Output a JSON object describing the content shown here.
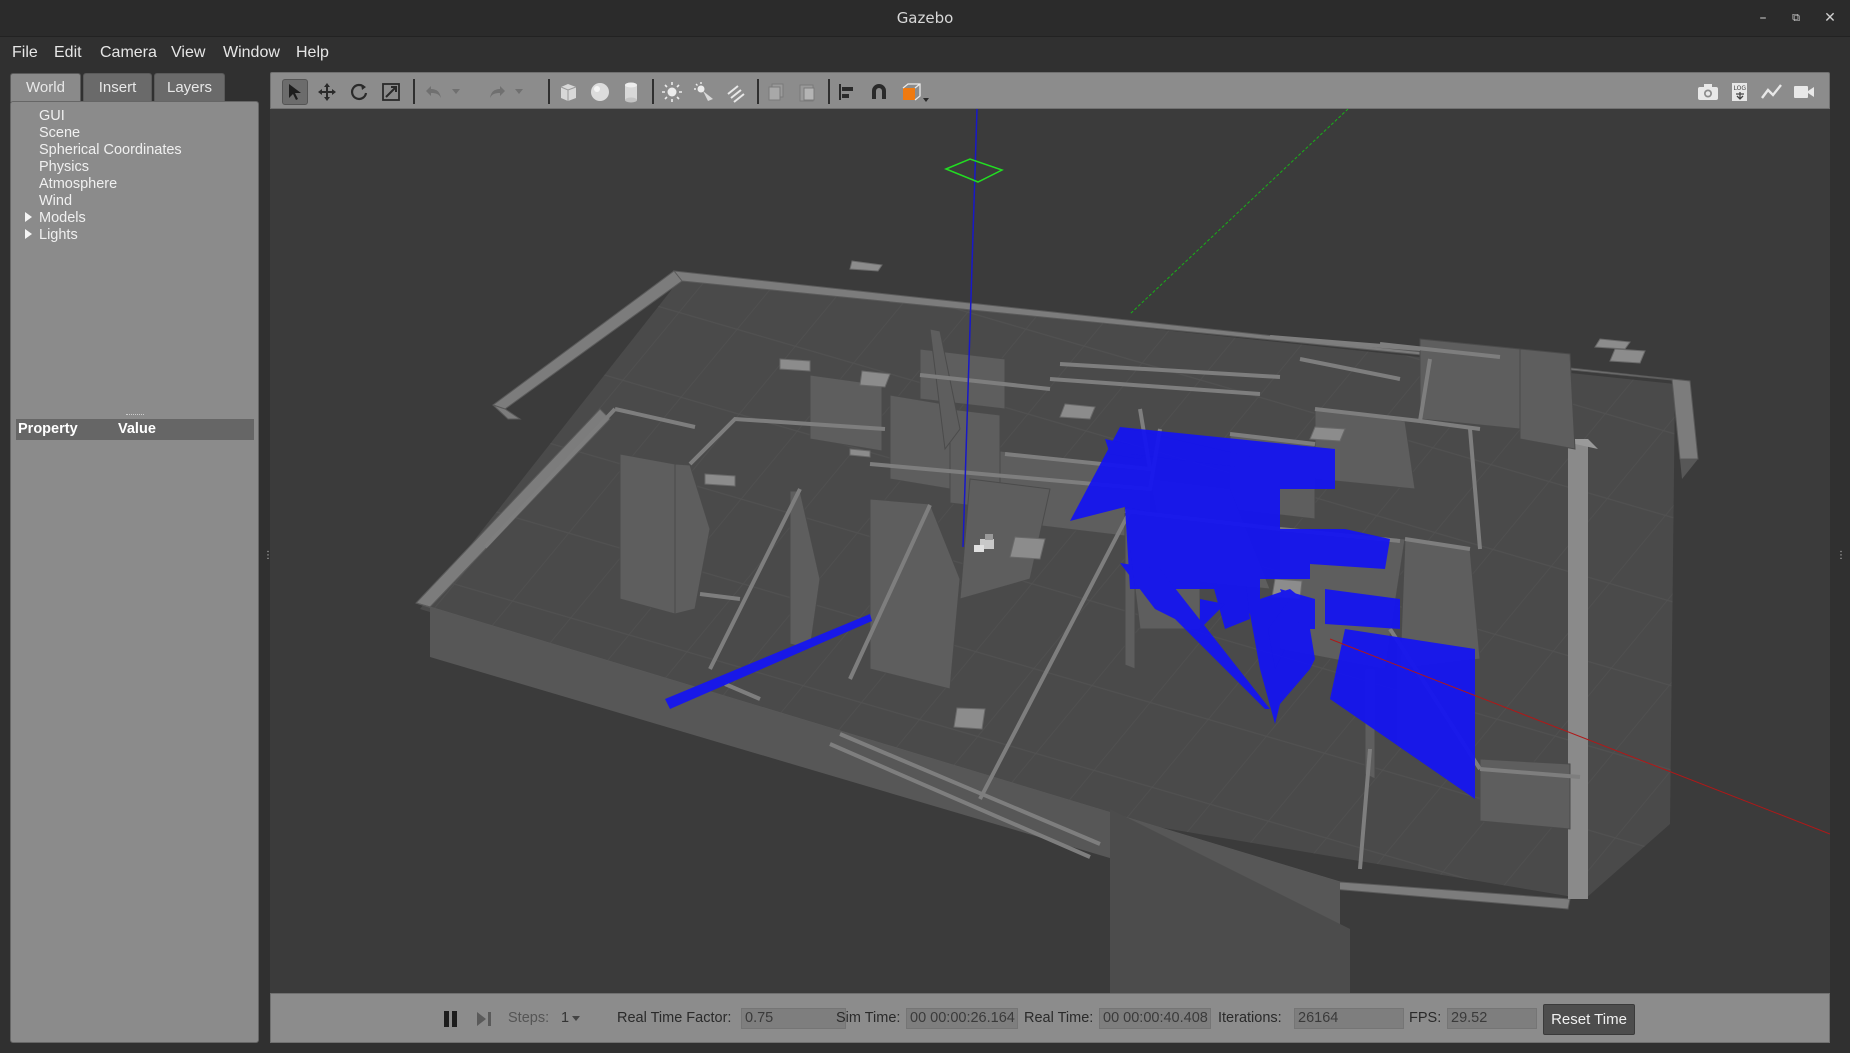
{
  "window": {
    "title": "Gazebo"
  },
  "menu": [
    "File",
    "Edit",
    "Camera",
    "View",
    "Window",
    "Help"
  ],
  "tabs": [
    {
      "label": "World",
      "active": true
    },
    {
      "label": "Insert",
      "active": false
    },
    {
      "label": "Layers",
      "active": false
    }
  ],
  "tree": [
    {
      "label": "GUI",
      "expandable": false
    },
    {
      "label": "Scene",
      "expandable": false
    },
    {
      "label": "Spherical Coordinates",
      "expandable": false
    },
    {
      "label": "Physics",
      "expandable": false
    },
    {
      "label": "Atmosphere",
      "expandable": false
    },
    {
      "label": "Wind",
      "expandable": false
    },
    {
      "label": "Models",
      "expandable": true
    },
    {
      "label": "Lights",
      "expandable": true
    }
  ],
  "properties": {
    "col_property": "Property",
    "col_value": "Value"
  },
  "toolbar": {
    "left_icons": [
      "select-arrow-icon",
      "translate-icon",
      "rotate-icon",
      "scale-icon",
      "undo-icon",
      "redo-icon",
      "box-icon",
      "sphere-icon",
      "cylinder-icon",
      "point-light-icon",
      "spot-light-icon",
      "directional-light-icon",
      "copy-icon",
      "paste-icon",
      "align-icon",
      "snap-magnet-icon",
      "view-angle-icon"
    ],
    "right_icons": [
      "screenshot-camera-icon",
      "log-icon",
      "plot-icon",
      "record-video-icon"
    ]
  },
  "bottom": {
    "steps_label": "Steps:",
    "steps_value": "1",
    "rtf_label": "Real Time Factor:",
    "rtf_value": "0.75",
    "sim_time_label": "Sim Time:",
    "sim_time_value": "00 00:00:26.164",
    "real_time_label": "Real Time:",
    "real_time_value": "00 00:00:40.408",
    "iterations_label": "Iterations:",
    "iterations_value": "26164",
    "fps_label": "FPS:",
    "fps_value": "29.52",
    "reset_label": "Reset Time"
  },
  "colors": {
    "laser_scan": "#1515f0",
    "x_axis": "#b01818",
    "y_axis": "#18b018",
    "z_axis": "#1818c8"
  }
}
